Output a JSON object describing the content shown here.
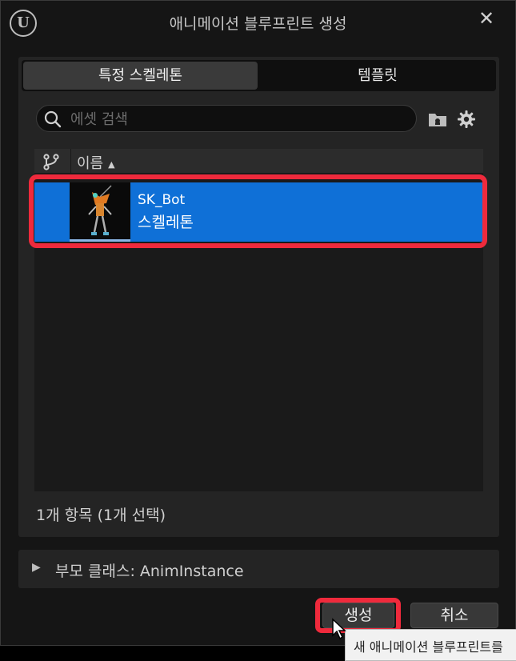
{
  "window": {
    "title": "애니메이션 블루프린트 생성",
    "close_label": "✕"
  },
  "tabs": [
    {
      "label": "특정 스켈레톤",
      "active": true
    },
    {
      "label": "템플릿",
      "active": false
    }
  ],
  "search": {
    "placeholder": "에셋 검색",
    "value": ""
  },
  "icons": [
    "unreal-logo-icon",
    "close-icon",
    "search-icon",
    "folder-icon",
    "gear-icon",
    "branch-icon",
    "sort-ascending-icon",
    "expand-arrow-icon",
    "mouse-cursor-icon"
  ],
  "list": {
    "column_name": "이름",
    "sort_arrow": "▲",
    "items": [
      {
        "name": "SK_Bot",
        "type": "스켈레톤",
        "selected": true
      }
    ],
    "count_text": "1개 항목 (1개 선택)"
  },
  "parent_class": {
    "arrow": "▶",
    "label": "부모 클래스: AnimInstance"
  },
  "buttons": {
    "create": "생성",
    "cancel": "취소"
  },
  "tooltip": {
    "text": "새 애니메이션 블루프린트를"
  },
  "colors": {
    "selection": "#0f70d7",
    "highlight": "#ef2a3c",
    "background": "#151515",
    "panel": "#242424"
  }
}
